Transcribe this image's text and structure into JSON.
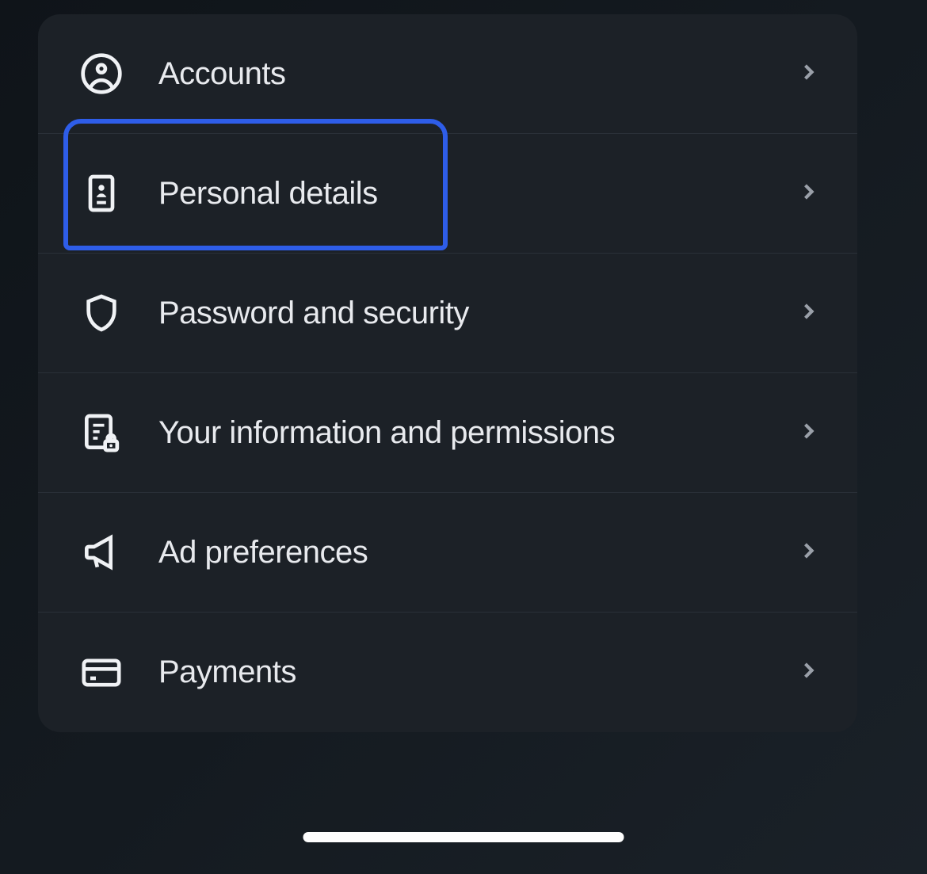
{
  "settings": {
    "items": [
      {
        "id": "accounts",
        "label": "Accounts",
        "icon": "user-circle-icon"
      },
      {
        "id": "personal-details",
        "label": "Personal details",
        "icon": "id-card-icon"
      },
      {
        "id": "password-security",
        "label": "Password and security",
        "icon": "shield-icon"
      },
      {
        "id": "info-permissions",
        "label": "Your information and permissions",
        "icon": "document-lock-icon"
      },
      {
        "id": "ad-preferences",
        "label": "Ad preferences",
        "icon": "megaphone-icon"
      },
      {
        "id": "payments",
        "label": "Payments",
        "icon": "credit-card-icon"
      }
    ]
  },
  "annotation": {
    "highlighted_item_index": 1,
    "color": "#2e5de8"
  }
}
